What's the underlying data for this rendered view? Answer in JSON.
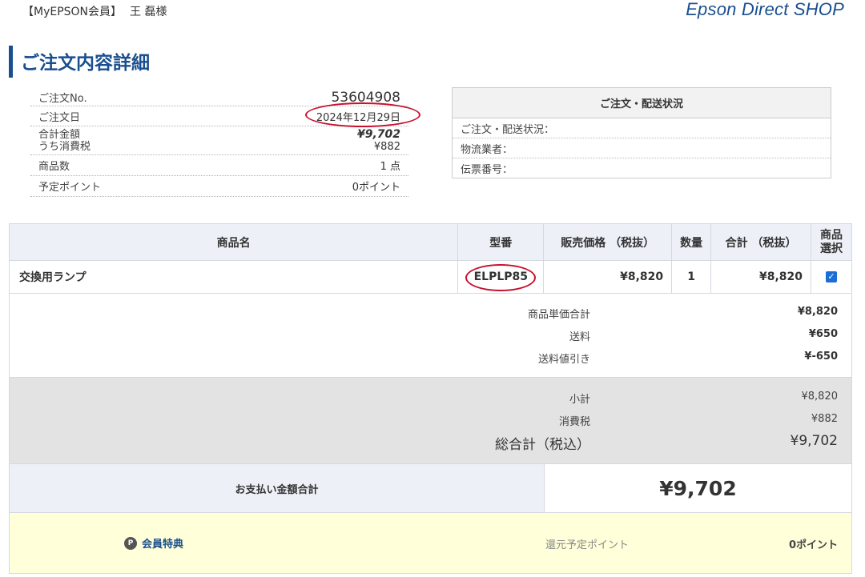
{
  "header": {
    "member_tag": "【MyEPSON会員】",
    "user_name": "王 磊様",
    "brand": "Epson Direct SHOP"
  },
  "page": {
    "title": "ご注文内容詳細"
  },
  "summary": {
    "order_no_label": "ご注文No.",
    "order_no": "53604908",
    "order_date_label": "ご注文日",
    "order_date": "2024年12月29日",
    "total_label": "合計金額",
    "total": "¥9,702",
    "tax_label": "うち消費税",
    "tax": "¥882",
    "item_count_label": "商品数",
    "item_count": "1 点",
    "points_label": "予定ポイント",
    "points": "0ポイント"
  },
  "status": {
    "title": "ご注文・配送状況",
    "status_label": "ご注文・配送状況：",
    "carrier_label": "物流業者：",
    "tracking_label": "伝票番号："
  },
  "products": {
    "headers": {
      "name": "商品名",
      "model": "型番",
      "price": "販売価格 （税抜）",
      "qty": "数量",
      "subtotal": "合計 （税抜）",
      "select_line1": "商品",
      "select_line2": "選択"
    },
    "rows": [
      {
        "name": "交換用ランプ",
        "model": "ELPLP85",
        "price": "¥8,820",
        "qty": "1",
        "subtotal": "¥8,820",
        "selected": true
      }
    ]
  },
  "subtotals": {
    "unit_total_label": "商品単価合計",
    "unit_total": "¥8,820",
    "shipping_label": "送料",
    "shipping": "¥650",
    "shipping_discount_label": "送料値引き",
    "shipping_discount": "¥-650"
  },
  "totals": {
    "subtotal_label": "小計",
    "subtotal": "¥8,820",
    "tax_label": "消費税",
    "tax": "¥882",
    "grand_label": "総合計（税込）",
    "grand": "¥9,702"
  },
  "payment": {
    "label": "お支払い金額合計",
    "amount": "¥9,702"
  },
  "benefit": {
    "label": "会員特典",
    "points_label": "還元予定ポイント",
    "points": "0ポイント"
  },
  "colors": {
    "brand_blue": "#1a4f8f",
    "annotation_red": "#c8102e",
    "checkbox_blue": "#1a6fd6",
    "benefit_bg": "#ffffd9",
    "totals_bg": "#e3e3e3"
  }
}
